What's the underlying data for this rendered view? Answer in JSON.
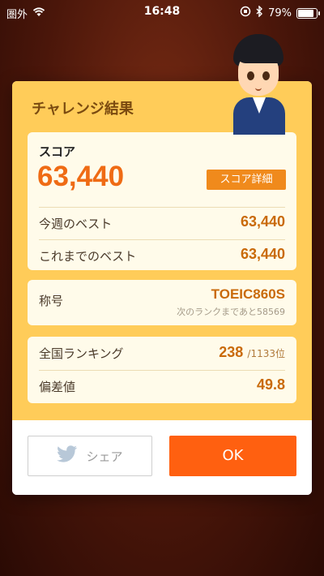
{
  "status_bar": {
    "carrier": "圏外",
    "time": "16:48",
    "battery": "79%"
  },
  "dialog": {
    "title": "チャレンジ結果",
    "score": {
      "label": "スコア",
      "value": "63,440",
      "detail_button": "スコア詳細"
    },
    "weekly_best": {
      "label": "今週のベスト",
      "value": "63,440"
    },
    "all_time_best": {
      "label": "これまでのベスト",
      "value": "63,440"
    },
    "title_section": {
      "label": "称号",
      "value": "TOEIC860S",
      "next_rank": "次のランクまであと58569"
    },
    "ranking": {
      "label": "全国ランキング",
      "rank": "238",
      "total": "/1133位"
    },
    "deviation": {
      "label": "偏差値",
      "value": "49.8"
    },
    "buttons": {
      "share": "シェア",
      "ok": "OK"
    }
  },
  "colors": {
    "dialog_top": "#ffcc59",
    "score": "#ef6b14",
    "ok_button": "#ff6010",
    "detail_button": "#f08a1c"
  }
}
